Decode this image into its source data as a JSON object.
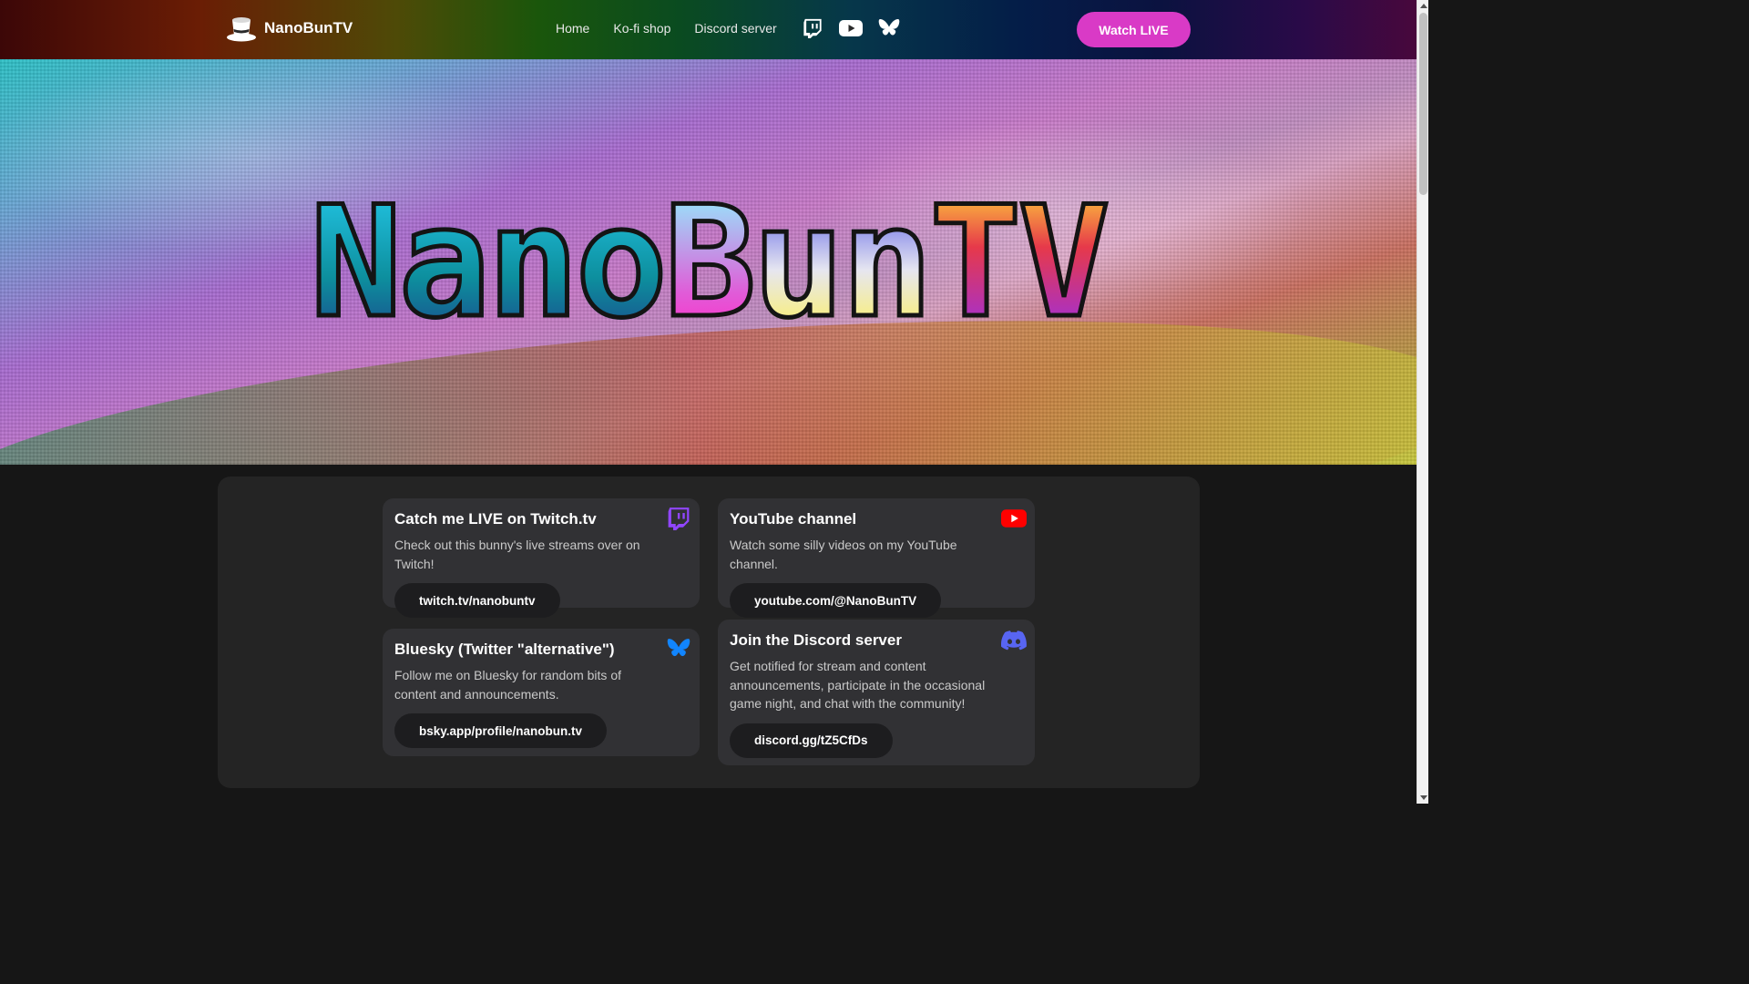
{
  "header": {
    "brand_name": "NanoBunTV",
    "brand_icon": "top-hat-icon",
    "nav_links": [
      "Home",
      "Ko-fi shop",
      "Discord server"
    ],
    "nav_icons": [
      "twitch-icon",
      "youtube-icon",
      "bluesky-icon"
    ],
    "watch_button": "Watch LIVE"
  },
  "hero": {
    "logo_text_parts": [
      "Nano",
      "B",
      "un",
      "TV"
    ]
  },
  "cards": [
    {
      "title": "Catch me LIVE on Twitch.tv",
      "description": "Check out this bunny's live streams over on Twitch!",
      "button": "twitch.tv/nanobuntv",
      "icon": "twitch-icon"
    },
    {
      "title": "YouTube channel",
      "description": "Watch some silly videos on my YouTube channel.",
      "button": "youtube.com/@NanoBunTV",
      "icon": "youtube-icon"
    },
    {
      "title": "Bluesky (Twitter \"alternative\")",
      "description": "Follow me on Bluesky for random bits of content and announcements.",
      "button": "bsky.app/profile/nanobun.tv",
      "icon": "bluesky-icon"
    },
    {
      "title": "Join the Discord server",
      "description": "Get notified for stream and content announcements, participate in the occasional game night, and chat with the community!",
      "button": "discord.gg/tZ5CfDs",
      "icon": "discord-icon"
    }
  ],
  "colors": {
    "accent_pink": "#d93ac6",
    "twitch_purple": "#9146ff",
    "youtube_red": "#ff0000",
    "bluesky_blue": "#1185fe",
    "discord_blurple": "#5865f2"
  }
}
